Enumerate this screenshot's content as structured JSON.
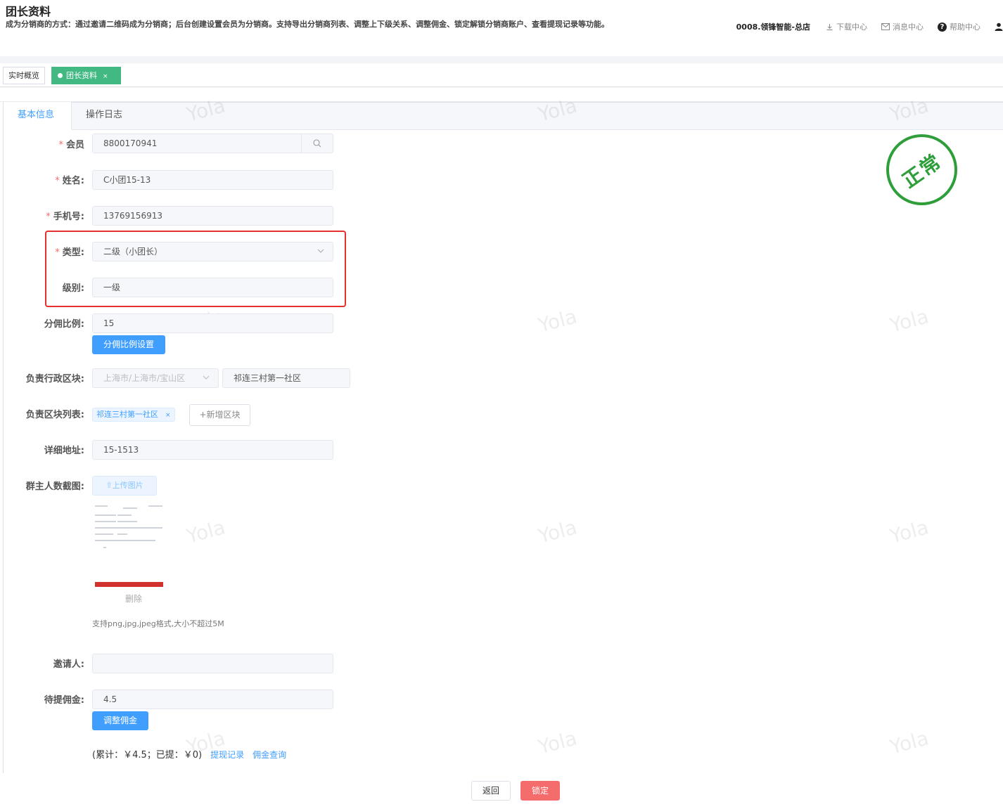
{
  "header": {
    "title": "团长资料",
    "description": "成为分销商的方式：通过邀请二维码成为分销商；后台创建设置会员为分销商。支持导出分销商列表、调整上下级关系、调整佣金、锁定解锁分销商账户、查看提现记录等功能。",
    "store_name": "0008.领锋智能-总店",
    "download_center": "下载中心",
    "message_center": "消息中心",
    "help_center": "帮助中心",
    "help_icon_char": "?"
  },
  "tags": {
    "overview": "实时概览",
    "active": "团长资料",
    "close": "×"
  },
  "tabs": {
    "basic": "基本信息",
    "log": "操作日志"
  },
  "form": {
    "required_mark": "*",
    "member_label": "会员",
    "member_value": "8800170941",
    "name_label": "姓名:",
    "name_value": "C小团15-13",
    "phone_label": "手机号:",
    "phone_value": "13769156913",
    "type_label": "类型:",
    "type_value": "二级（小团长）",
    "level_label": "级别:",
    "level_value": "一级",
    "ratio_label": "分佣比例:",
    "ratio_value": "15",
    "ratio_button": "分佣比例设置",
    "region_label": "负责行政区块:",
    "region_select": "上海市/上海市/宝山区",
    "region_community": "祁连三村第一社区",
    "region_list_label": "负责区块列表:",
    "region_tag": "祁连三村第一社区",
    "region_tag_close": "×",
    "add_region": "+新增区块",
    "address_label": "详细地址:",
    "address_value": "15-1513",
    "screenshot_label": "群主人数截图:",
    "upload_button": "⇧上传图片",
    "delete": "删除",
    "upload_hint": "支持png,jpg,jpeg格式,大小不超过5M",
    "inviter_label": "邀请人:",
    "inviter_value": "",
    "pending_label": "待提佣金:",
    "pending_value": "4.5",
    "adjust_button": "调整佣金",
    "summary_text": "(累计：￥4.5；已提：￥0)",
    "withdraw_link": "提现记录",
    "commission_link": "佣金查询"
  },
  "stamp": {
    "text": "正常",
    "color": "#2e9e3a"
  },
  "watermark": "Yola",
  "footer": {
    "back": "返回",
    "lock": "锁定"
  },
  "colors": {
    "accent": "#409eff",
    "tag_active": "#42b983",
    "danger": "#f56c6c",
    "highlight_border": "#e5302f"
  }
}
